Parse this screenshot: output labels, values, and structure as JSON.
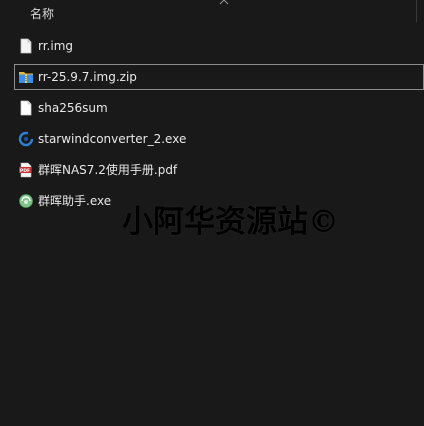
{
  "header": {
    "name_column": "名称"
  },
  "files": [
    {
      "name": "rr.img",
      "icon": "file-icon",
      "selected": false
    },
    {
      "name": "rr-25.9.7.img.zip",
      "icon": "zip-folder-icon",
      "selected": true
    },
    {
      "name": "sha256sum",
      "icon": "file-icon",
      "selected": false
    },
    {
      "name": "starwindconverter_2.exe",
      "icon": "starwind-app-icon",
      "selected": false
    },
    {
      "name": "群晖NAS7.2使用手册.pdf",
      "icon": "pdf-icon",
      "selected": false
    },
    {
      "name": "群晖助手.exe",
      "icon": "synology-assistant-icon",
      "selected": false
    }
  ],
  "watermark": "小阿华资源站©",
  "colors": {
    "background": "#191919",
    "text": "#e8e8e8",
    "selection_border": "#8c8c8c",
    "pdf_red": "#c8302c",
    "zip_blue": "#3d8ee8",
    "zip_yellow": "#e8b830"
  }
}
